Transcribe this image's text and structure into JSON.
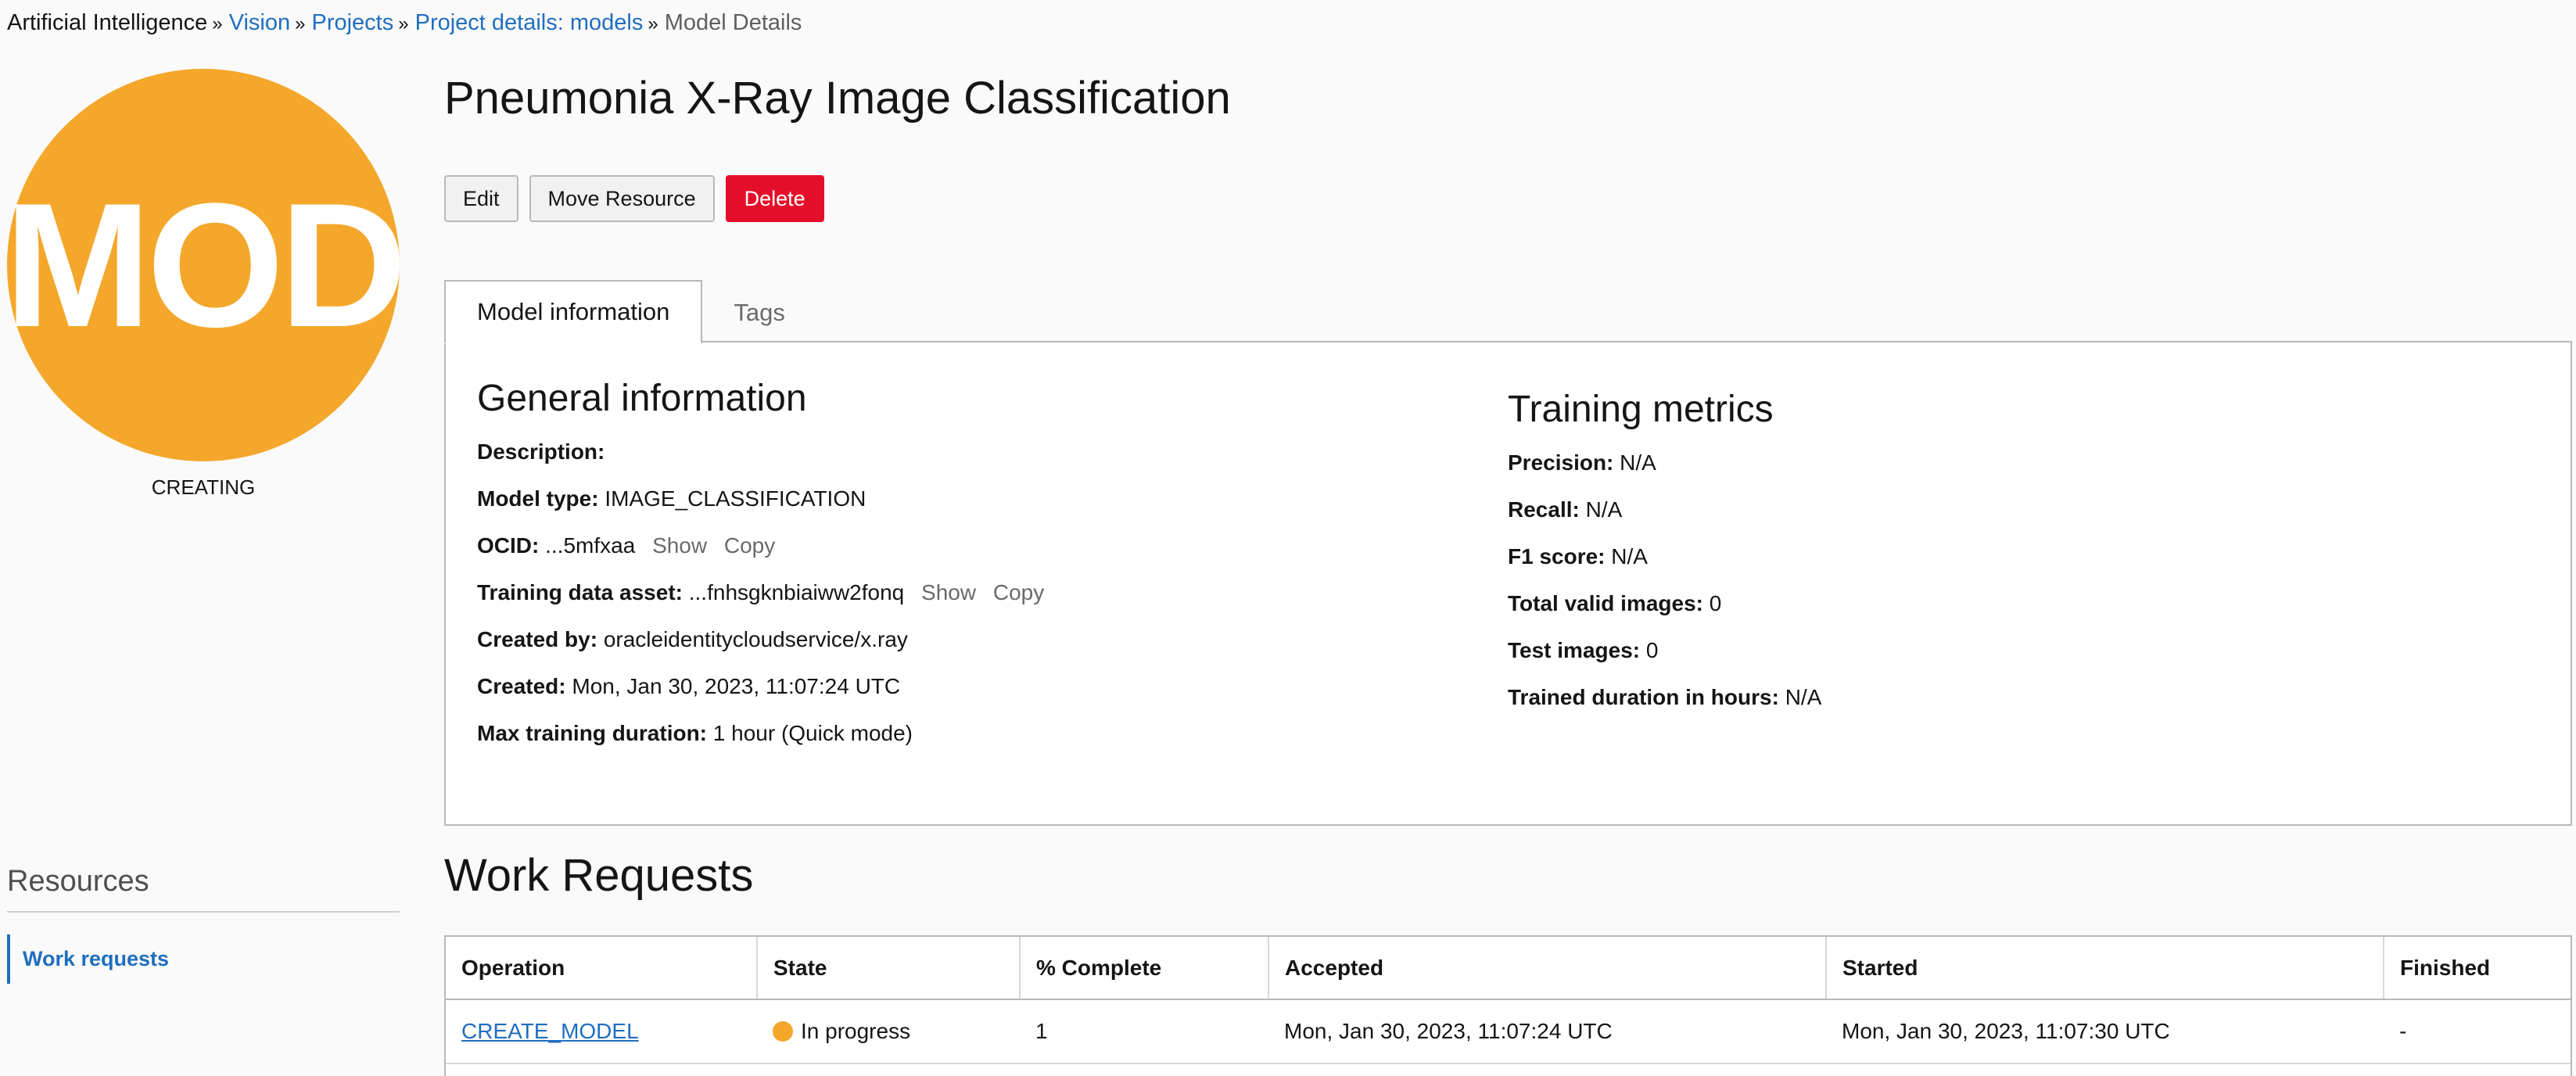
{
  "breadcrumb": {
    "root": "Artificial Intelligence",
    "vision": "Vision",
    "projects": "Projects",
    "project_details": "Project details: models",
    "current": "Model Details",
    "separator": "»"
  },
  "avatar": {
    "initials": "MOD",
    "color": "#f4a72b",
    "state": "CREATING"
  },
  "resources": {
    "title": "Resources",
    "items": [
      {
        "label": "Work requests"
      }
    ]
  },
  "title": "Pneumonia X-Ray Image Classification",
  "actions": {
    "edit": "Edit",
    "move": "Move Resource",
    "delete": "Delete"
  },
  "tabs": {
    "model_info": "Model information",
    "tags": "Tags"
  },
  "general": {
    "title": "General information",
    "description_label": "Description:",
    "description_value": "",
    "model_type_label": "Model type:",
    "model_type_value": "IMAGE_CLASSIFICATION",
    "ocid_label": "OCID:",
    "ocid_value": "...5mfxaa",
    "ocid_show": "Show",
    "ocid_copy": "Copy",
    "training_asset_label": "Training data asset:",
    "training_asset_value": "...fnhsgknbiaiww2fonq",
    "training_asset_show": "Show",
    "training_asset_copy": "Copy",
    "created_by_label": "Created by:",
    "created_by_value": "oracleidentitycloudservice/x.ray",
    "created_label": "Created:",
    "created_value": "Mon, Jan 30, 2023, 11:07:24 UTC",
    "max_duration_label": "Max training duration:",
    "max_duration_value": "1 hour (Quick mode)"
  },
  "metrics": {
    "title": "Training metrics",
    "precision_label": "Precision:",
    "precision_value": "N/A",
    "recall_label": "Recall:",
    "recall_value": "N/A",
    "f1_label": "F1 score:",
    "f1_value": "N/A",
    "total_valid_label": "Total valid images:",
    "total_valid_value": "0",
    "test_images_label": "Test images:",
    "test_images_value": "0",
    "trained_duration_label": "Trained duration in hours:",
    "trained_duration_value": "N/A"
  },
  "work_requests": {
    "title": "Work Requests",
    "columns": [
      "Operation",
      "State",
      "% Complete",
      "Accepted",
      "Started",
      "Finished"
    ],
    "rows": [
      {
        "operation": "CREATE_MODEL",
        "state": "In progress",
        "state_color": "#f4a72b",
        "percent": "1",
        "accepted": "Mon, Jan 30, 2023, 11:07:24 UTC",
        "started": "Mon, Jan 30, 2023, 11:07:30 UTC",
        "finished": "-"
      }
    ]
  }
}
